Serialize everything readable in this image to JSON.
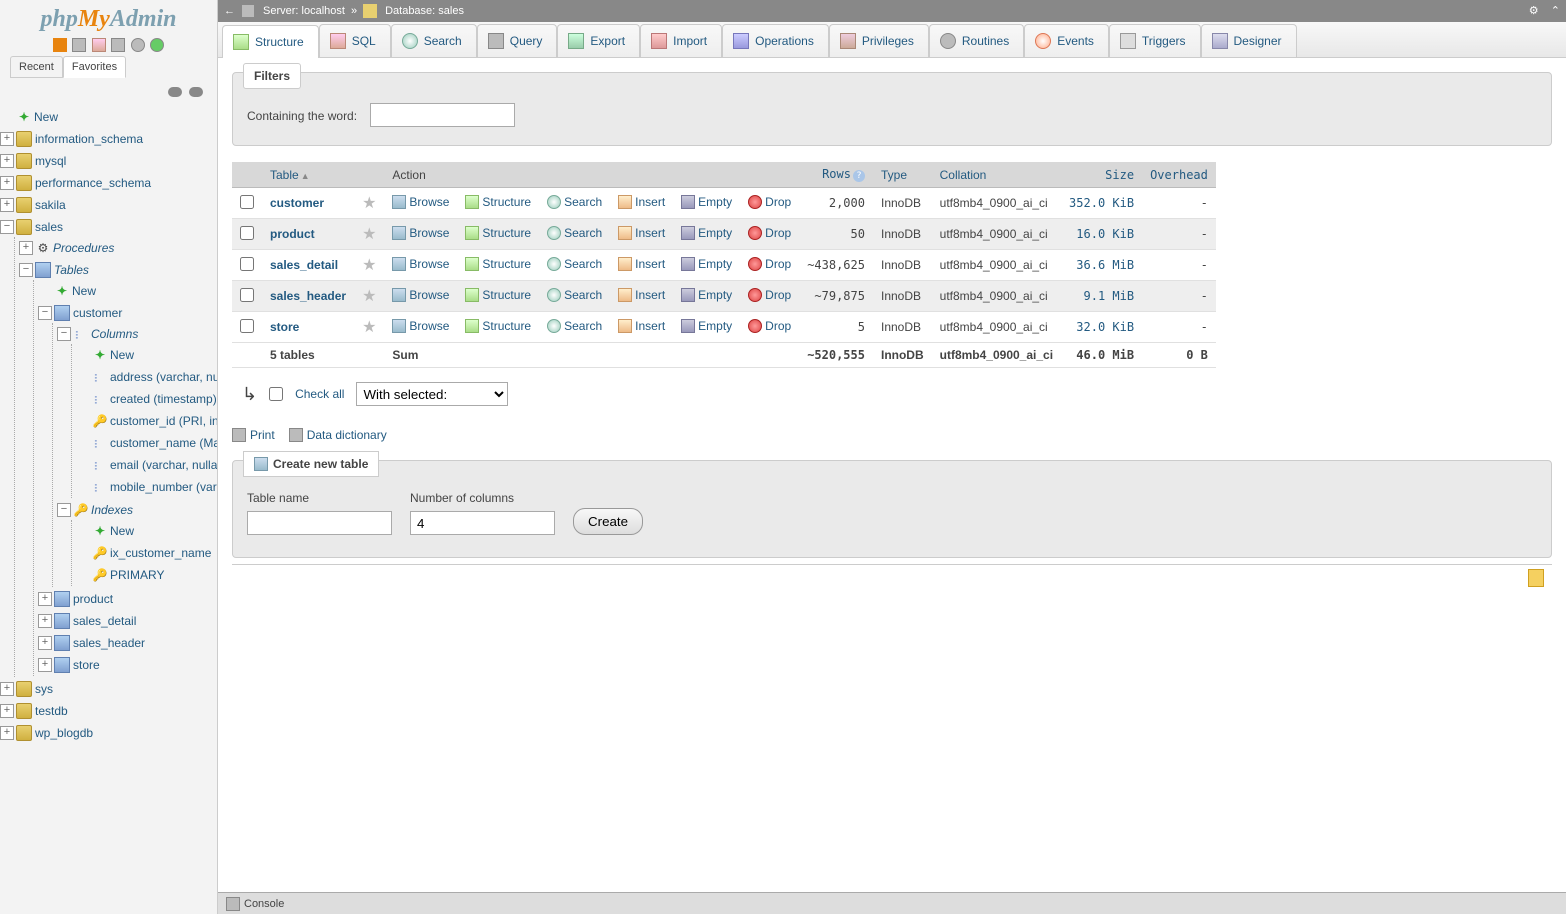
{
  "logo": {
    "p1": "php",
    "p2": "My",
    "p3": "Admin"
  },
  "sidebar": {
    "tabs": {
      "recent": "Recent",
      "favorites": "Favorites"
    },
    "new": "New",
    "dbs": [
      "information_schema",
      "mysql",
      "performance_schema",
      "sakila"
    ],
    "sales_label": "sales",
    "procedures": "Procedures",
    "tables": "Tables",
    "tree_new": "New",
    "customer": "customer",
    "columns": "Columns",
    "cols": [
      "New",
      "address (varchar, nullable)",
      "created (timestamp)",
      "customer_id (PRI, int)",
      "customer_name (Mandatory)",
      "email (varchar, nullable)",
      "mobile_number (varchar)"
    ],
    "indexes": "Indexes",
    "idx": [
      "New",
      "ix_customer_name",
      "PRIMARY"
    ],
    "other_tables": [
      "product",
      "sales_detail",
      "sales_header",
      "store"
    ],
    "below_dbs": [
      "sys",
      "testdb",
      "wp_blogdb"
    ]
  },
  "crumb": {
    "server_label": "Server:",
    "server": "localhost",
    "db_label": "Database:",
    "db": "sales"
  },
  "tabs": [
    {
      "id": "structure",
      "label": "Structure",
      "active": true
    },
    {
      "id": "sql",
      "label": "SQL"
    },
    {
      "id": "search",
      "label": "Search"
    },
    {
      "id": "query",
      "label": "Query"
    },
    {
      "id": "export",
      "label": "Export"
    },
    {
      "id": "import",
      "label": "Import"
    },
    {
      "id": "operations",
      "label": "Operations"
    },
    {
      "id": "privileges",
      "label": "Privileges"
    },
    {
      "id": "routines",
      "label": "Routines"
    },
    {
      "id": "events",
      "label": "Events"
    },
    {
      "id": "triggers",
      "label": "Triggers"
    },
    {
      "id": "designer",
      "label": "Designer"
    }
  ],
  "filters": {
    "title": "Filters",
    "label": "Containing the word:",
    "value": ""
  },
  "cols": {
    "table": "Table",
    "action": "Action",
    "rows": "Rows",
    "type": "Type",
    "collation": "Collation",
    "size": "Size",
    "overhead": "Overhead"
  },
  "actions": {
    "browse": "Browse",
    "structure": "Structure",
    "search": "Search",
    "insert": "Insert",
    "empty": "Empty",
    "drop": "Drop"
  },
  "rows": [
    {
      "name": "customer",
      "rows": "2,000",
      "type": "InnoDB",
      "collation": "utf8mb4_0900_ai_ci",
      "size": "352.0 KiB",
      "overhead": "-"
    },
    {
      "name": "product",
      "rows": "50",
      "type": "InnoDB",
      "collation": "utf8mb4_0900_ai_ci",
      "size": "16.0 KiB",
      "overhead": "-"
    },
    {
      "name": "sales_detail",
      "rows": "~438,625",
      "type": "InnoDB",
      "collation": "utf8mb4_0900_ai_ci",
      "size": "36.6 MiB",
      "overhead": "-"
    },
    {
      "name": "sales_header",
      "rows": "~79,875",
      "type": "InnoDB",
      "collation": "utf8mb4_0900_ai_ci",
      "size": "9.1 MiB",
      "overhead": "-"
    },
    {
      "name": "store",
      "rows": "5",
      "type": "InnoDB",
      "collation": "utf8mb4_0900_ai_ci",
      "size": "32.0 KiB",
      "overhead": "-"
    }
  ],
  "sum": {
    "label": "5 tables",
    "action": "Sum",
    "rows": "~520,555",
    "type": "InnoDB",
    "collation": "utf8mb4_0900_ai_ci",
    "size": "46.0 MiB",
    "overhead": "0 B"
  },
  "below": {
    "check_all": "Check all",
    "with_selected": "With selected:"
  },
  "util": {
    "print": "Print",
    "dict": "Data dictionary"
  },
  "create": {
    "title": "Create new table",
    "name_label": "Table name",
    "cols_label": "Number of columns",
    "cols_value": "4",
    "btn": "Create"
  },
  "console": "Console"
}
